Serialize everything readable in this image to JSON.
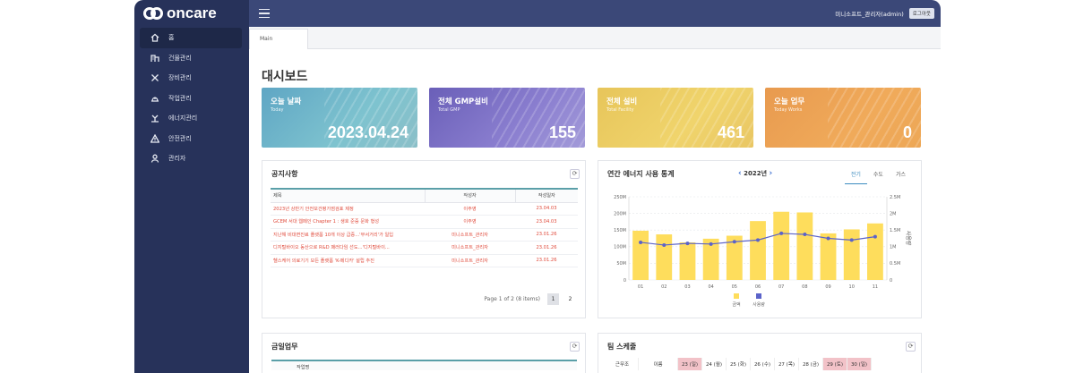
{
  "brand": {
    "name": "oncare"
  },
  "sidebar": {
    "items": [
      {
        "label": "홈",
        "icon": "home-icon"
      },
      {
        "label": "건물관리",
        "icon": "building-icon"
      },
      {
        "label": "장비관리",
        "icon": "tools-icon"
      },
      {
        "label": "작업관리",
        "icon": "helmet-icon"
      },
      {
        "label": "에너지관리",
        "icon": "fan-icon"
      },
      {
        "label": "안전관리",
        "icon": "warning-icon"
      },
      {
        "label": "관리자",
        "icon": "user-icon"
      }
    ]
  },
  "header": {
    "user": "미니소프트_관리자(admin)",
    "logout": "로그아웃"
  },
  "tabs": [
    {
      "label": "Main"
    }
  ],
  "page": {
    "title": "대시보드"
  },
  "cards": [
    {
      "title": "오늘 날짜",
      "subtitle": "Today",
      "value": "2023.04.24"
    },
    {
      "title": "전체 GMP설비",
      "subtitle": "Total GMP",
      "value": "155"
    },
    {
      "title": "전체 설비",
      "subtitle": "Total Facility",
      "value": "461"
    },
    {
      "title": "오늘 업무",
      "subtitle": "Today Works",
      "value": "0"
    }
  ],
  "notice": {
    "title": "공지사항",
    "columns": [
      "제목",
      "작성자",
      "작성일자"
    ],
    "rows": [
      {
        "title": "2023년 상반기 안전보건평가점검표 제정",
        "author": "이주영",
        "date": "23.04.03"
      },
      {
        "title": "GCEM 서대 웹페인 Chapter 1 : 생호 준중 문화 형성",
        "author": "이주영",
        "date": "23.04.03"
      },
      {
        "title": "지난해 비대면진료 플랫폼 10개 이상 급증...'무서거리'가 일입",
        "author": "미니소프트_관리자",
        "date": "23.01.26"
      },
      {
        "title": "디지털바이오 동산으로 R&D 패러다임 선도...'디지털바이...",
        "author": "미니소프트_관리자",
        "date": "23.01.26"
      },
      {
        "title": "헬스케어 의료기기 모든 플랫폼 'K-메디카' 설립 추진",
        "author": "미니소프트_관리자",
        "date": "23.01.26"
      }
    ],
    "pager": {
      "info": "Page 1 of 2 (8 items)",
      "pages": [
        "1",
        "2"
      ]
    }
  },
  "energy": {
    "title": "연간 에너지 사용 통계",
    "year": "2022년",
    "tabs": [
      "전기",
      "수도",
      "가스"
    ]
  },
  "chart_data": {
    "type": "bar",
    "categories": [
      "01",
      "02",
      "03",
      "04",
      "05",
      "06",
      "07",
      "08",
      "09",
      "10",
      "11"
    ],
    "series": [
      {
        "name": "금액",
        "type": "bar",
        "axis": "left",
        "values": [
          148,
          137,
          113,
          124,
          133,
          177,
          205,
          203,
          140,
          152,
          170
        ]
      },
      {
        "name": "사용량",
        "type": "line",
        "axis": "right",
        "values": [
          1.13,
          1.05,
          1.1,
          1.08,
          1.15,
          1.2,
          1.4,
          1.37,
          1.25,
          1.2,
          1.3
        ]
      }
    ],
    "yleft": {
      "ticks": [
        "0",
        "50M",
        "100M",
        "150M",
        "200M",
        "250M"
      ],
      "range": [
        0,
        250
      ]
    },
    "yright": {
      "ticks": [
        "0",
        "0.5M",
        "1M",
        "1.5M",
        "2M",
        "2.5M"
      ],
      "range": [
        0,
        2.5
      ],
      "label": "사용량"
    },
    "colors": {
      "bar": "#fedd5c",
      "line": "#5b63c9"
    },
    "legend": "bottom-center"
  },
  "today_work": {
    "title": "금일업무",
    "column": "작업명"
  },
  "team": {
    "title": "팀 스케줄",
    "headers": [
      "근무조",
      "이름",
      "23 (일)",
      "24 (월)",
      "25 (화)",
      "26 (수)",
      "27 (목)",
      "28 (금)",
      "29 (토)",
      "30 (일)"
    ]
  }
}
